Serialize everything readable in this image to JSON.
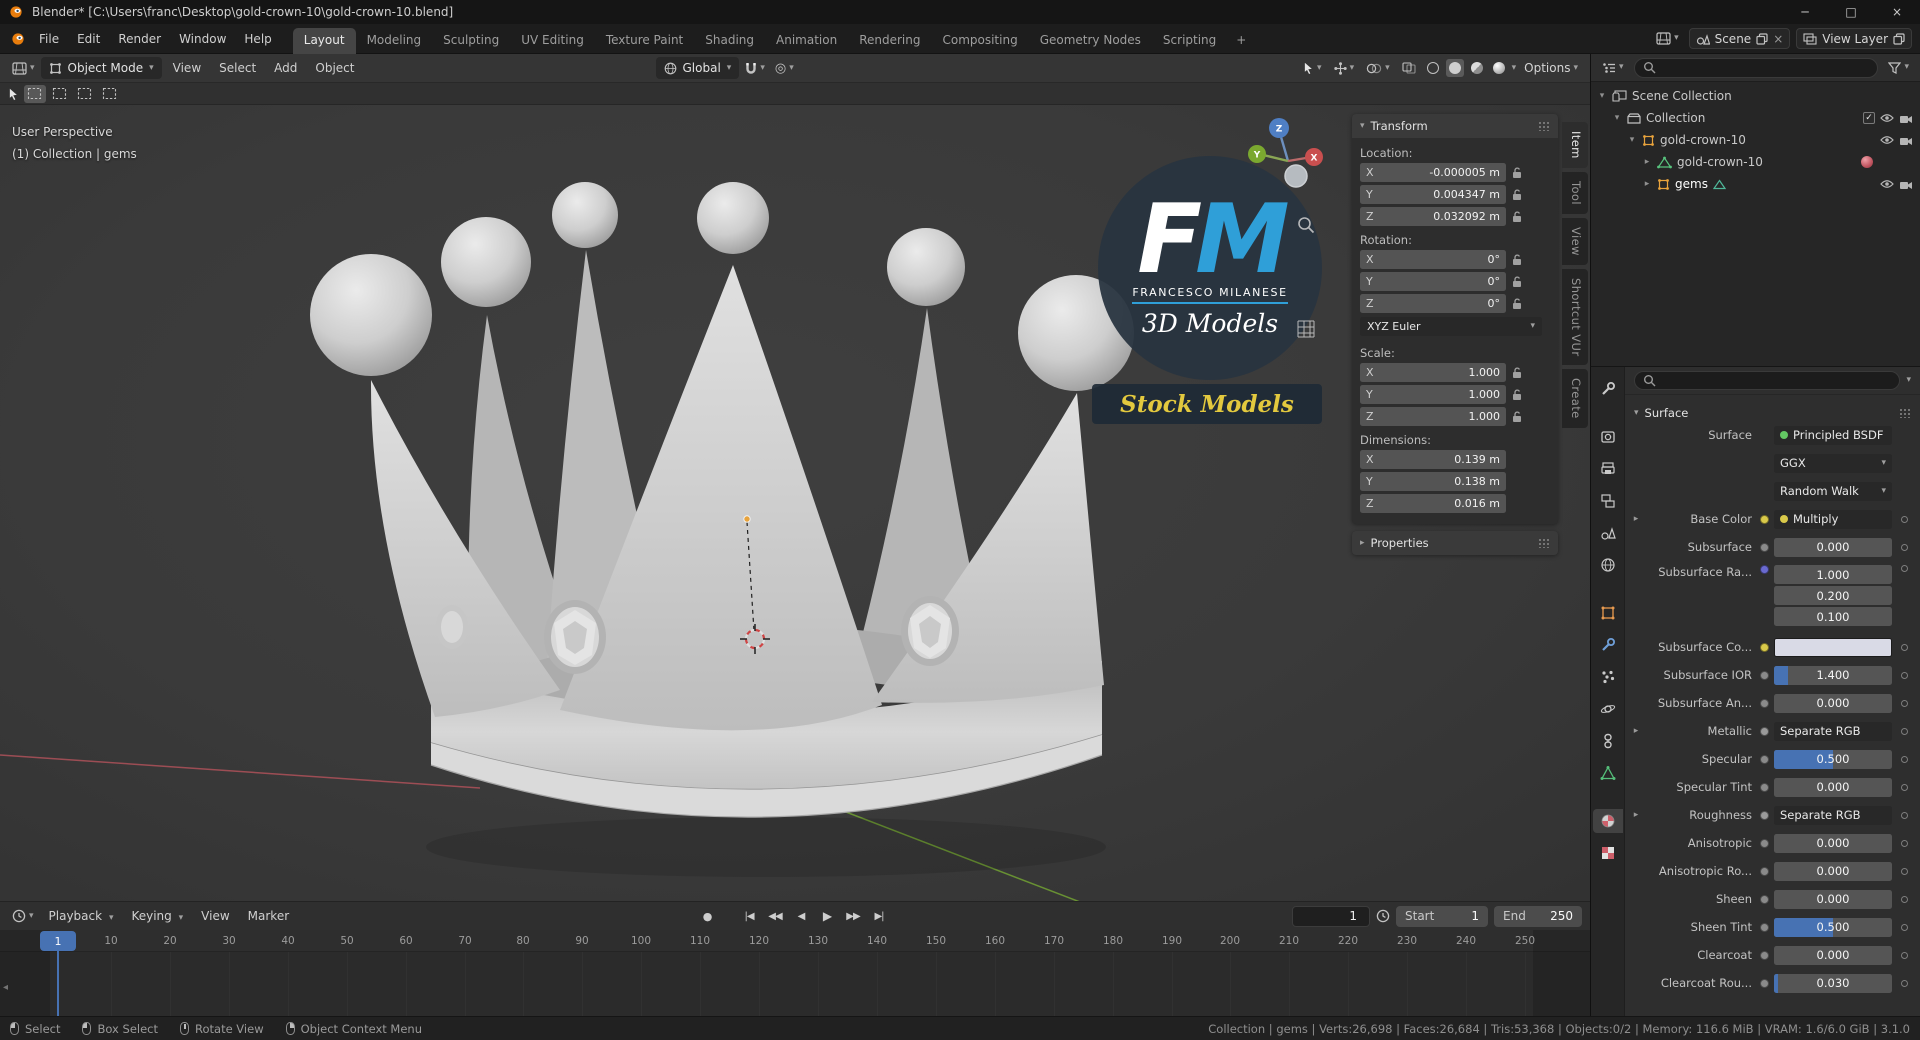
{
  "window": {
    "title": "Blender* [C:\\Users\\franc\\Desktop\\gold-crown-10\\gold-crown-10.blend]"
  },
  "topbar": {
    "menus": [
      "File",
      "Edit",
      "Render",
      "Window",
      "Help"
    ],
    "workspaces": [
      "Layout",
      "Modeling",
      "Sculpting",
      "UV Editing",
      "Texture Paint",
      "Shading",
      "Animation",
      "Rendering",
      "Compositing",
      "Geometry Nodes",
      "Scripting"
    ],
    "active_workspace": "Layout",
    "add_workspace": "+",
    "scene_name": "Scene",
    "view_layer_name": "View Layer"
  },
  "viewport": {
    "header": {
      "mode": "Object Mode",
      "menus": [
        "View",
        "Select",
        "Add",
        "Object"
      ],
      "orientation": "Global",
      "options": "Options"
    },
    "overlay": {
      "perspective": "User Perspective",
      "collection": "(1) Collection | gems"
    },
    "gizmo_labels": {
      "x": "X",
      "y": "Y",
      "z": "Z"
    },
    "watermark": {
      "initial_f": "F",
      "initial_m": "M",
      "name": "FRANCESCO MILANESE",
      "tagline": "3D Models",
      "badge": "Stock Models"
    }
  },
  "sidebar": {
    "tabs": [
      {
        "label": "Item",
        "active": true
      },
      {
        "label": "Tool",
        "active": false
      },
      {
        "label": "View",
        "active": false
      },
      {
        "label": "Shortcut VUr",
        "active": false
      },
      {
        "label": "Create",
        "active": false
      }
    ],
    "transform": {
      "title": "Transform",
      "sections": [
        {
          "kind": "fields",
          "label": "Location:",
          "locks": true,
          "rows": [
            {
              "axis": "X",
              "value": "-0.000005 m"
            },
            {
              "axis": "Y",
              "value": "0.004347 m"
            },
            {
              "axis": "Z",
              "value": "0.032092 m"
            }
          ]
        },
        {
          "kind": "fields",
          "label": "Rotation:",
          "locks": true,
          "rows": [
            {
              "axis": "X",
              "value": "0°"
            },
            {
              "axis": "Y",
              "value": "0°"
            },
            {
              "axis": "Z",
              "value": "0°"
            }
          ]
        },
        {
          "kind": "dropdown",
          "value": "XYZ Euler"
        },
        {
          "kind": "fields",
          "label": "Scale:",
          "locks": true,
          "rows": [
            {
              "axis": "X",
              "value": "1.000"
            },
            {
              "axis": "Y",
              "value": "1.000"
            },
            {
              "axis": "Z",
              "value": "1.000"
            }
          ]
        },
        {
          "kind": "fields",
          "label": "Dimensions:",
          "locks": false,
          "rows": [
            {
              "axis": "X",
              "value": "0.139 m"
            },
            {
              "axis": "Y",
              "value": "0.138 m"
            },
            {
              "axis": "Z",
              "value": "0.016 m"
            }
          ]
        }
      ]
    },
    "collapsed_panel": "Properties"
  },
  "outliner": {
    "items": [
      {
        "label": "Scene Collection",
        "depth": 0,
        "icon": "scene-collection",
        "arrow": "down",
        "controls": [],
        "selected": false
      },
      {
        "label": "Collection",
        "depth": 1,
        "icon": "collection",
        "arrow": "down",
        "controls": [
          "checkbox",
          "eye",
          "camera"
        ],
        "selected": false
      },
      {
        "label": "gold-crown-10",
        "depth": 2,
        "icon": "object-orange",
        "arrow": "down",
        "controls": [
          "eye",
          "camera"
        ],
        "selected": false
      },
      {
        "label": "gold-crown-10",
        "depth": 3,
        "icon": "mesh-green",
        "arrow": "right",
        "controls": [
          "material-ball"
        ],
        "selected": false
      },
      {
        "label": "gems",
        "depth": 3,
        "icon": "object-orange",
        "arrow": "right",
        "extra_icon": "mesh-data",
        "controls": [
          "eye",
          "camera"
        ],
        "selected": true
      }
    ]
  },
  "properties": {
    "tabs": [
      {
        "name": "tool",
        "active": false
      },
      {
        "name": "render",
        "active": false
      },
      {
        "name": "output",
        "active": false
      },
      {
        "name": "view-layer",
        "active": false
      },
      {
        "name": "scene",
        "active": false
      },
      {
        "name": "world",
        "active": false
      },
      {
        "name": "object",
        "active": false
      },
      {
        "name": "modifiers",
        "active": false
      },
      {
        "name": "particles",
        "active": false
      },
      {
        "name": "physics",
        "active": false
      },
      {
        "name": "constraints",
        "active": false
      },
      {
        "name": "object-data",
        "active": false
      },
      {
        "name": "material",
        "active": true
      },
      {
        "name": "texture",
        "active": false
      }
    ],
    "panel_title": "Surface",
    "rows": [
      {
        "label": "Surface",
        "type": "node",
        "value": "Principled BSDF",
        "value_dot": "#63c763",
        "decorator": false
      },
      {
        "label": "",
        "type": "dropdown",
        "value": "GGX",
        "decorator": false
      },
      {
        "label": "",
        "type": "dropdown",
        "value": "Random Walk",
        "decorator": false
      },
      {
        "label": "Base Color",
        "arrow": true,
        "type": "node",
        "value": "Multiply",
        "socket": "#d9c94a",
        "value_dot": "#d9c94a",
        "decorator": true
      },
      {
        "label": "Subsurface",
        "type": "slider",
        "value": "0.000",
        "fill": 0,
        "decorator": true
      },
      {
        "label": "Subsurface Ra...",
        "type": "vector",
        "values": [
          "1.000",
          "0.200",
          "0.100"
        ],
        "socket": "#6a6ad0",
        "decorator": true
      },
      {
        "label": "Subsurface Co...",
        "type": "color",
        "swatch": "#d9dae6",
        "socket": "#d9c94a",
        "decorator": true
      },
      {
        "label": "Subsurface IOR",
        "type": "slider",
        "value": "1.400",
        "fill": 0.12,
        "decorator": true
      },
      {
        "label": "Subsurface An...",
        "type": "slider",
        "value": "0.000",
        "fill": 0,
        "decorator": true
      },
      {
        "label": "Metallic",
        "arrow": true,
        "type": "node",
        "value": "Separate RGB",
        "socket": "#9a9a9a",
        "decorator": true
      },
      {
        "label": "Specular",
        "type": "slider",
        "value": "0.500",
        "fill": 0.5,
        "decorator": true
      },
      {
        "label": "Specular Tint",
        "type": "slider",
        "value": "0.000",
        "fill": 0,
        "decorator": true
      },
      {
        "label": "Roughness",
        "arrow": true,
        "type": "node",
        "value": "Separate RGB",
        "socket": "#9a9a9a",
        "decorator": true
      },
      {
        "label": "Anisotropic",
        "type": "slider",
        "value": "0.000",
        "fill": 0,
        "decorator": true
      },
      {
        "label": "Anisotropic Ro...",
        "type": "slider",
        "value": "0.000",
        "fill": 0,
        "decorator": true
      },
      {
        "label": "Sheen",
        "type": "slider",
        "value": "0.000",
        "fill": 0,
        "decorator": true
      },
      {
        "label": "Sheen Tint",
        "type": "slider",
        "value": "0.500",
        "fill": 0.5,
        "decorator": true
      },
      {
        "label": "Clearcoat",
        "type": "slider",
        "value": "0.000",
        "fill": 0,
        "decorator": true
      },
      {
        "label": "Clearcoat Rou...",
        "type": "slider",
        "value": "0.030",
        "fill": 0.03,
        "decorator": true
      }
    ]
  },
  "timeline": {
    "menus": [
      {
        "label": "Playback",
        "chevron": true
      },
      {
        "label": "Keying",
        "chevron": true
      },
      {
        "label": "View",
        "chevron": false
      },
      {
        "label": "Marker",
        "chevron": false
      }
    ],
    "transport": [
      "jump-start",
      "prev-keyframe",
      "play-reverse",
      "play",
      "next-keyframe",
      "jump-end"
    ],
    "current_frame": "1",
    "start_label": "Start",
    "start_value": "1",
    "end_label": "End",
    "end_value": "250",
    "frame_ticks": [
      1,
      10,
      20,
      30,
      40,
      50,
      60,
      70,
      80,
      90,
      100,
      110,
      120,
      130,
      140,
      150,
      160,
      170,
      180,
      190,
      200,
      210,
      220,
      230,
      240,
      250
    ],
    "playhead_frame": 1
  },
  "status_bar": {
    "hints": [
      {
        "icon": "mouse-left",
        "label": "Select"
      },
      {
        "icon": "mouse-left",
        "label": "Box Select"
      },
      {
        "icon": "mouse-middle",
        "label": "Rotate View"
      },
      {
        "icon": "mouse-right",
        "label": "Object Context Menu"
      }
    ],
    "stats": "Collection | gems | Verts:26,698 | Faces:26,684 | Tris:53,368 | Objects:0/2 | Memory: 116.6 MiB | VRAM: 1.6/6.0 GiB | 3.1.0"
  }
}
